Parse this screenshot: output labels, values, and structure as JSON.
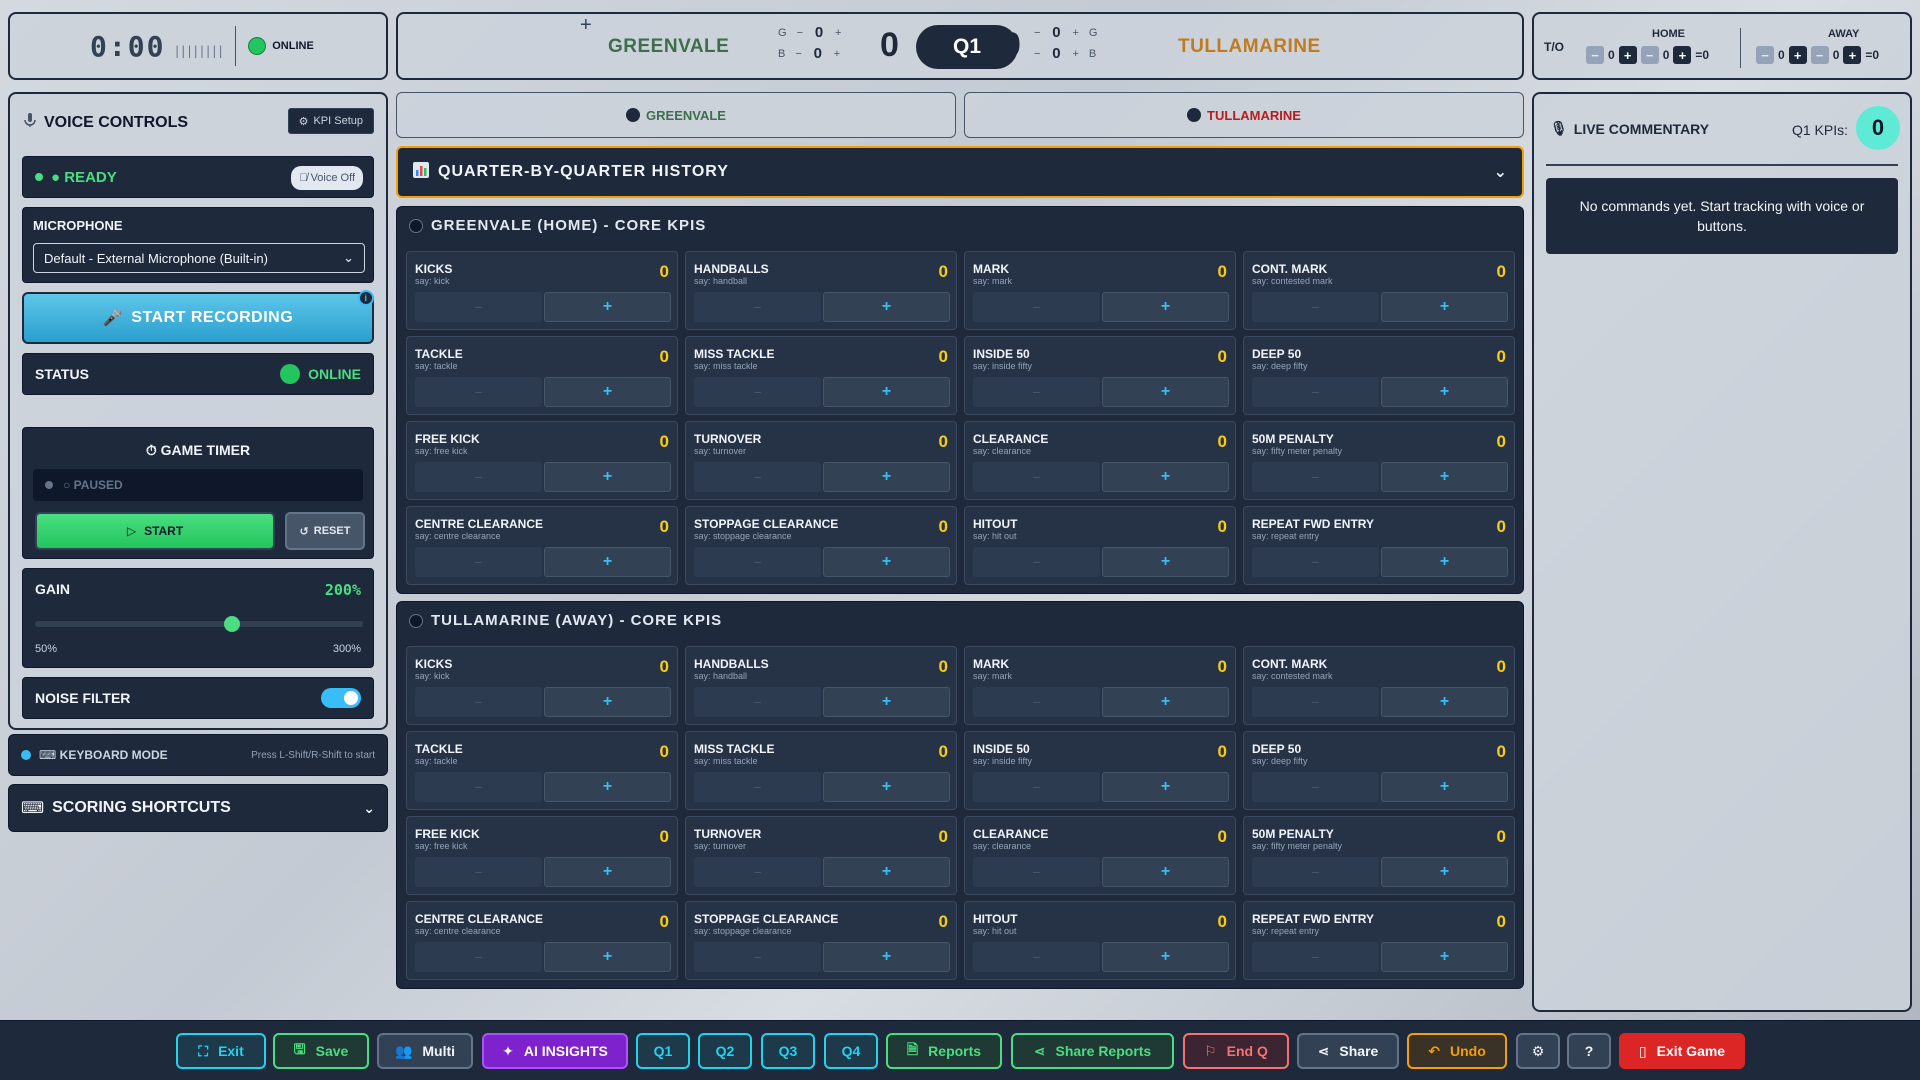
{
  "timer": {
    "clock": "0:00",
    "ticks": "||||||||",
    "status": "ONLINE"
  },
  "scoreboard": {
    "home_name": "GREENVALE",
    "away_name": "TULLAMARINE",
    "goal_letter": "G",
    "behind_letter": "B",
    "home_goals": "0",
    "home_behinds": "0",
    "home_total": "0",
    "away_goals": "0",
    "away_behinds": "0",
    "away_total": "0",
    "quarter": "Q1",
    "minus": "−",
    "plus": "+"
  },
  "timeouts": {
    "label": "T/O",
    "home_label": "HOME",
    "away_label": "AWAY",
    "home_a": "0",
    "home_b": "0",
    "home_total": "=0",
    "away_a": "0",
    "away_b": "0",
    "away_total": "=0"
  },
  "voice": {
    "title": "VOICE CONTROLS",
    "kpi_setup": "KPI Setup",
    "ready": "● READY",
    "voice_off": "Voice Off",
    "mic_label": "MICROPHONE",
    "mic_value": "Default - External Microphone (Built-in)",
    "record": "START RECORDING",
    "status_label": "STATUS",
    "status_value": "ONLINE",
    "game_timer": "GAME TIMER",
    "paused": "○ PAUSED",
    "start": "START",
    "reset": "RESET",
    "gain_label": "GAIN",
    "gain_value": "200%",
    "gain_level": 0.6,
    "gain_min": "50%",
    "gain_max": "300%",
    "noise_filter": "NOISE FILTER"
  },
  "keyboard": {
    "title": "KEYBOARD MODE",
    "hint": "Press L-Shift/R-Shift to start"
  },
  "shortcuts": {
    "title": "SCORING SHORTCUTS"
  },
  "tabs": {
    "home": "GREENVALE",
    "away": "TULLAMARINE"
  },
  "history": {
    "title": "QUARTER-BY-QUARTER HISTORY"
  },
  "sections": [
    {
      "title": "GREENVALE (HOME) - CORE KPIS"
    },
    {
      "title": "TULLAMARINE (AWAY) - CORE KPIS"
    }
  ],
  "kpis": [
    {
      "name": "KICKS",
      "say": "say: kick"
    },
    {
      "name": "HANDBALLS",
      "say": "say: handball"
    },
    {
      "name": "MARK",
      "say": "say: mark"
    },
    {
      "name": "CONT. MARK",
      "say": "say: contested mark"
    },
    {
      "name": "TACKLE",
      "say": "say: tackle"
    },
    {
      "name": "MISS TACKLE",
      "say": "say: miss tackle"
    },
    {
      "name": "INSIDE 50",
      "say": "say: inside fifty"
    },
    {
      "name": "DEEP 50",
      "say": "say: deep fifty"
    },
    {
      "name": "FREE KICK",
      "say": "say: free kick"
    },
    {
      "name": "TURNOVER",
      "say": "say: turnover"
    },
    {
      "name": "CLEARANCE",
      "say": "say: clearance"
    },
    {
      "name": "50M PENALTY",
      "say": "say: fifty meter penalty"
    },
    {
      "name": "CENTRE CLEARANCE",
      "say": "say: centre clearance"
    },
    {
      "name": "STOPPAGE CLEARANCE",
      "say": "say: stoppage clearance"
    },
    {
      "name": "HITOUT",
      "say": "say: hit out"
    },
    {
      "name": "REPEAT FWD ENTRY",
      "say": "say: repeat entry"
    }
  ],
  "kpi_count": "0",
  "kpi_minus": "−",
  "kpi_plus": "+",
  "commentary": {
    "title": "LIVE COMMENTARY",
    "kpi_label": "Q1 KPIs:",
    "kpi_value": "0",
    "empty": "No commands yet. Start tracking with voice or buttons."
  },
  "bottom": {
    "exit": "Exit",
    "save": "Save",
    "multi": "Multi",
    "ai": "AI INSIGHTS",
    "q1": "Q1",
    "q2": "Q2",
    "q3": "Q3",
    "q4": "Q4",
    "reports": "Reports",
    "share_reports": "Share Reports",
    "end_q": "End Q",
    "share": "Share",
    "undo": "Undo",
    "exit_game": "Exit Game"
  },
  "colors": {
    "home": "#3f6e4a",
    "away": "#c07a1f",
    "accent": "#38bdf8",
    "ok": "#22c55e",
    "warn": "#f59e0b",
    "danger": "#dc2626"
  }
}
